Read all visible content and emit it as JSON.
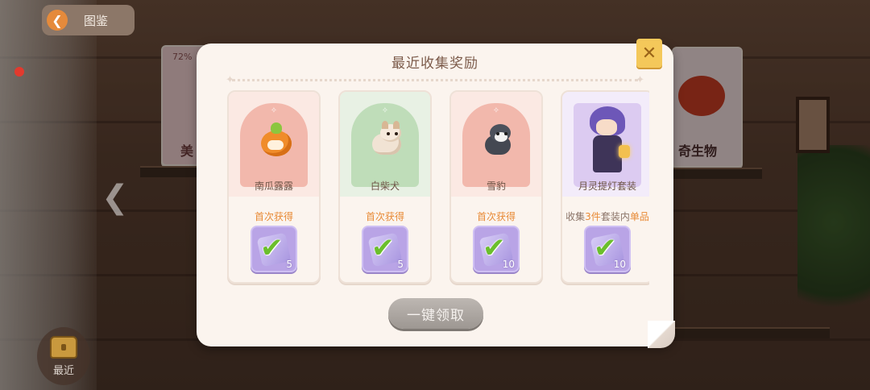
{
  "header": {
    "back_label": "图鉴"
  },
  "background": {
    "left_card_percent": "72%",
    "left_card_text": "美",
    "right_card_text": "奇生物"
  },
  "bottom_left": {
    "recent_label": "最近"
  },
  "dialog": {
    "title": "最近收集奖励",
    "claim_all_label": "一键领取",
    "claim_all_enabled": false,
    "items": [
      {
        "name": "南瓜露露",
        "condition": "首次获得",
        "reward_qty": "5",
        "claimed": true
      },
      {
        "name": "白柴犬",
        "condition": "首次获得",
        "reward_qty": "5",
        "claimed": true
      },
      {
        "name": "雪豹",
        "condition": "首次获得",
        "reward_qty": "10",
        "claimed": true
      },
      {
        "name": "月灵提灯套装",
        "condition_prefix": "收集",
        "condition_count": "3件",
        "condition_mid": "套装内",
        "condition_suffix": "单品",
        "reward_qty": "10",
        "claimed": true
      }
    ]
  },
  "colors": {
    "accent_orange": "#e88a36",
    "reward_purple": "#b9a4e6",
    "check_green": "#6bbf2c",
    "close_yellow": "#f4c85a"
  }
}
